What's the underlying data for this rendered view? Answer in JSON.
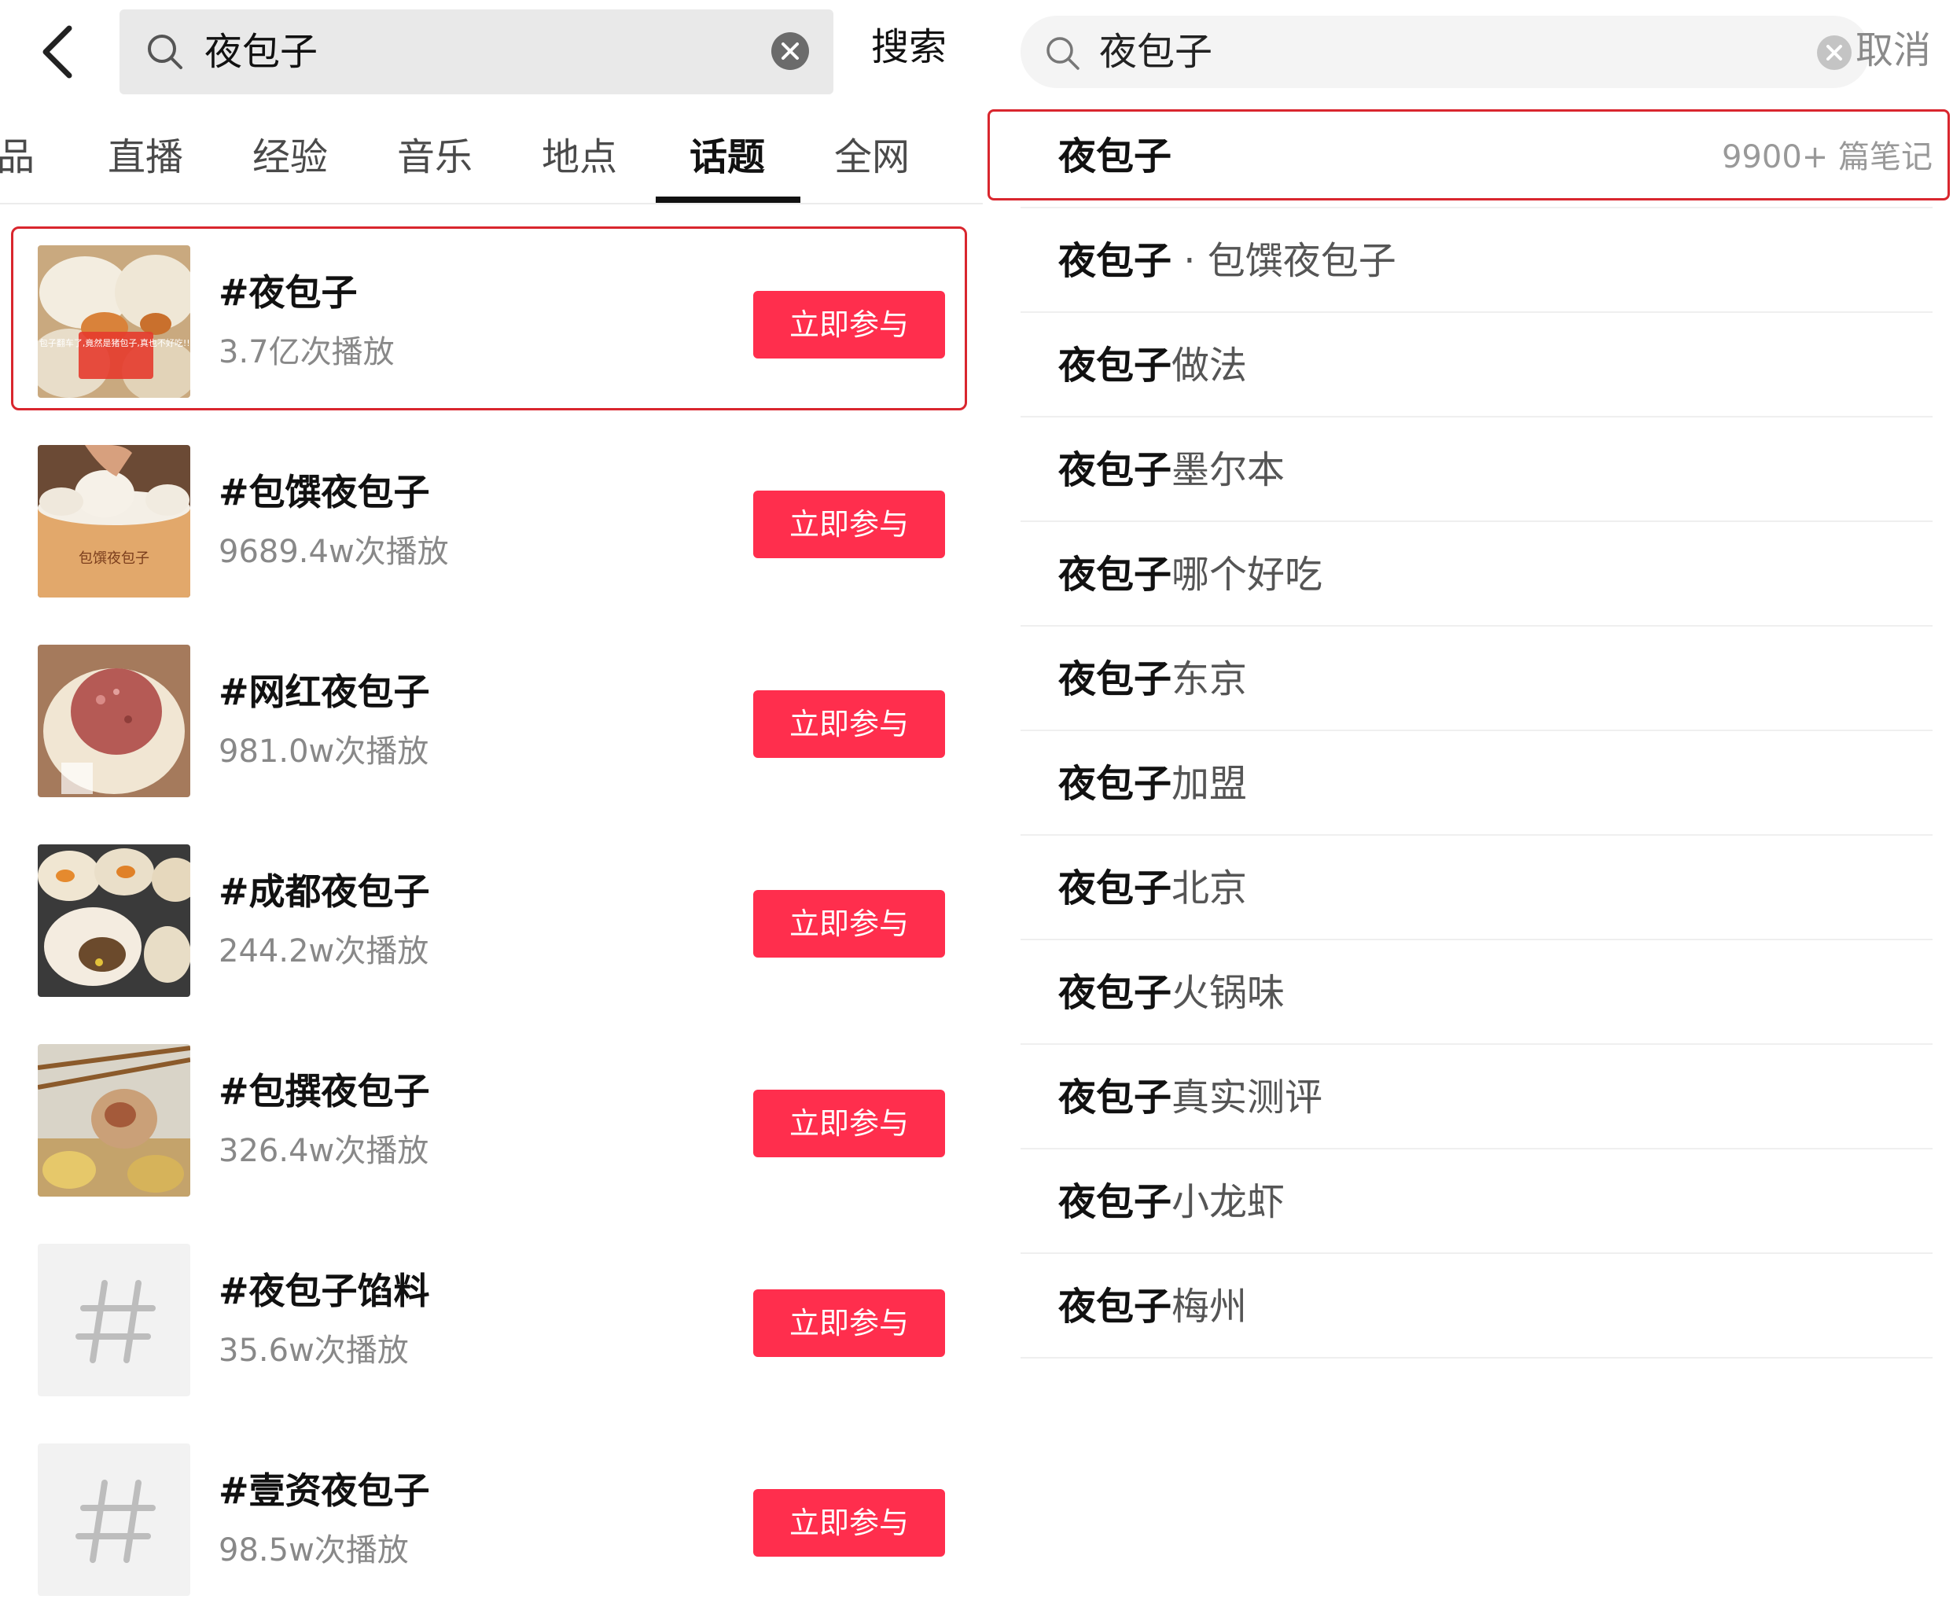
{
  "left_panel": {
    "search": {
      "query": "夜包子",
      "button_label": "搜索"
    },
    "tabs": [
      {
        "label": "品"
      },
      {
        "label": "直播"
      },
      {
        "label": "经验"
      },
      {
        "label": "音乐"
      },
      {
        "label": "地点"
      },
      {
        "label": "话题",
        "active": true
      },
      {
        "label": "全网"
      }
    ],
    "topics": [
      {
        "title": "#夜包子",
        "plays": "3.7亿次播放",
        "button": "立即参与",
        "thumb": "photo",
        "overlay_text": "包子翻车了,竟然是猪包子,真也不好吃!!!"
      },
      {
        "title": "#包馔夜包子",
        "plays": "9689.4w次播放",
        "button": "立即参与",
        "thumb": "photo",
        "overlay_text": "包馔夜包子"
      },
      {
        "title": "#网红夜包子",
        "plays": "981.0w次播放",
        "button": "立即参与",
        "thumb": "photo"
      },
      {
        "title": "#成都夜包子",
        "plays": "244.2w次播放",
        "button": "立即参与",
        "thumb": "photo"
      },
      {
        "title": "#包撰夜包子",
        "plays": "326.4w次播放",
        "button": "立即参与",
        "thumb": "photo"
      },
      {
        "title": "#夜包子馅料",
        "plays": "35.6w次播放",
        "button": "立即参与",
        "thumb": "hashtag"
      },
      {
        "title": "#壹资夜包子",
        "plays": "98.5w次播放",
        "button": "立即参与",
        "thumb": "hashtag"
      }
    ]
  },
  "right_panel": {
    "search": {
      "query": "夜包子",
      "cancel_label": "取消"
    },
    "suggestions": [
      {
        "query": "夜包子",
        "rest": "",
        "count": "9900+ 篇笔记"
      },
      {
        "query": "夜包子",
        "rest": " · 包馔夜包子"
      },
      {
        "query": "夜包子",
        "rest": "做法"
      },
      {
        "query": "夜包子",
        "rest": "墨尔本"
      },
      {
        "query": "夜包子",
        "rest": "哪个好吃"
      },
      {
        "query": "夜包子",
        "rest": "东京"
      },
      {
        "query": "夜包子",
        "rest": "加盟"
      },
      {
        "query": "夜包子",
        "rest": "北京"
      },
      {
        "query": "夜包子",
        "rest": "火锅味"
      },
      {
        "query": "夜包子",
        "rest": "真实测评"
      },
      {
        "query": "夜包子",
        "rest": "小龙虾"
      },
      {
        "query": "夜包子",
        "rest": "梅州"
      }
    ]
  },
  "colors": {
    "accent_red": "#ff2e4d",
    "highlight_border": "#d9262e"
  },
  "icons": [
    "back-arrow-icon",
    "search-icon",
    "clear-icon",
    "hashtag-icon"
  ]
}
